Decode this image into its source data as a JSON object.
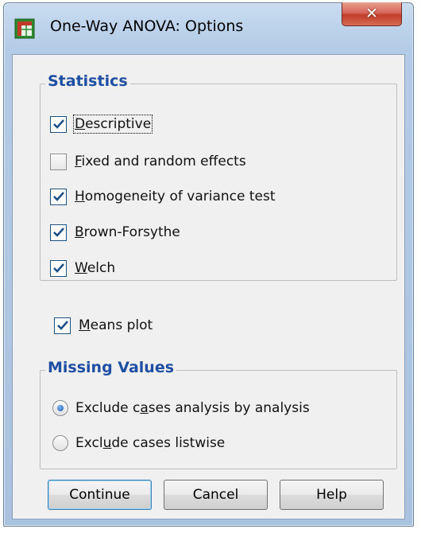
{
  "window": {
    "title": "One-Way ANOVA: Options",
    "icon": "spss-table-icon",
    "close_icon": "close-icon"
  },
  "statistics": {
    "title": "Statistics",
    "items": [
      {
        "label": "Descriptive",
        "mnemonic": "D",
        "checked": true
      },
      {
        "label": "Fixed and random effects",
        "mnemonic": "F",
        "checked": false
      },
      {
        "label": "Homogeneity of variance test",
        "mnemonic": "H",
        "checked": true
      },
      {
        "label": "Brown-Forsythe",
        "mnemonic": "B",
        "checked": true
      },
      {
        "label": "Welch",
        "mnemonic": "W",
        "checked": true
      }
    ]
  },
  "means_plot": {
    "label": "Means plot",
    "mnemonic": "M",
    "checked": true
  },
  "missing_values": {
    "title": "Missing Values",
    "options": [
      {
        "label": "Exclude cases analysis by analysis",
        "selected": true
      },
      {
        "label": "Exclude cases listwise",
        "selected": false
      }
    ]
  },
  "buttons": {
    "continue": "Continue",
    "cancel": "Cancel",
    "help": "Help"
  },
  "colors": {
    "group_title": "#1f4fa3",
    "close_button": "#c13d2b",
    "checkmark": "#1c4f8a"
  }
}
